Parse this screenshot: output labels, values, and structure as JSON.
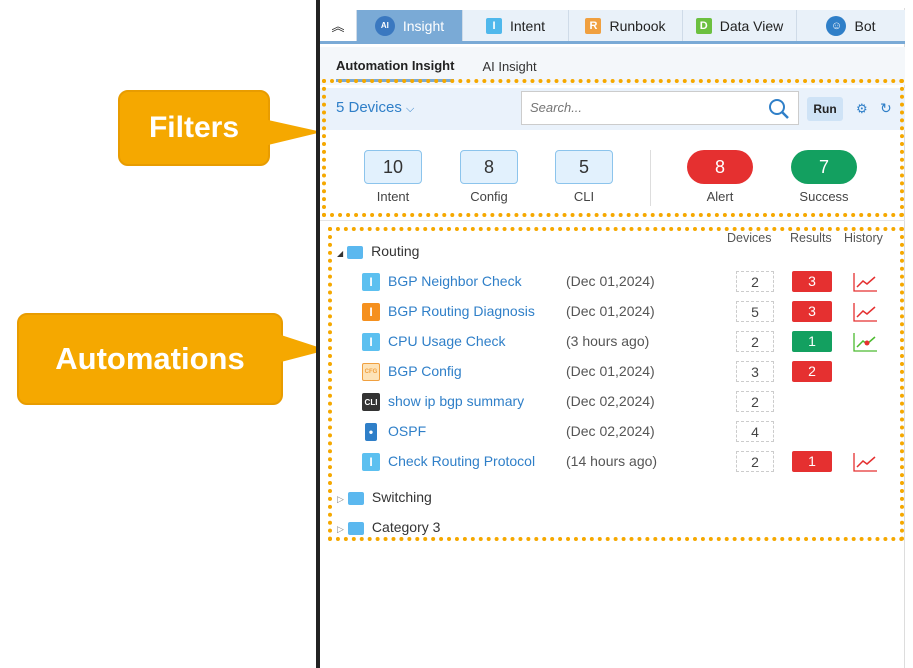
{
  "callouts": {
    "filters": "Filters",
    "automations": "Automations"
  },
  "tabs": [
    {
      "label": "Insight",
      "icon": "ai-insight-icon",
      "active": true
    },
    {
      "label": "Intent",
      "icon": "intent-icon",
      "letter": "I"
    },
    {
      "label": "Runbook",
      "icon": "runbook-icon",
      "letter": "R"
    },
    {
      "label": "Data View",
      "icon": "data-view-icon",
      "letter": "D"
    },
    {
      "label": "Bot",
      "icon": "bot-icon"
    }
  ],
  "subtabs": [
    {
      "label": "Automation Insight",
      "active": true
    },
    {
      "label": "AI Insight"
    }
  ],
  "filters": {
    "devices": "5 Devices",
    "search_placeholder": "Search...",
    "run": "Run"
  },
  "counts": [
    {
      "value": "10",
      "label": "Intent"
    },
    {
      "value": "8",
      "label": "Config"
    },
    {
      "value": "5",
      "label": "CLI"
    }
  ],
  "statuses": [
    {
      "value": "8",
      "label": "Alert",
      "color": "#e53030"
    },
    {
      "value": "7",
      "label": "Success",
      "color": "#13a060"
    }
  ],
  "columns": {
    "devices": "Devices",
    "results": "Results",
    "history": "History"
  },
  "folders": [
    {
      "name": "Routing",
      "expanded": true
    },
    {
      "name": "Switching"
    },
    {
      "name": "Category 3"
    }
  ],
  "automations": [
    {
      "name": "BGP Neighbor Check",
      "date": "(Dec 01,2024)",
      "devices": "2",
      "result": "3",
      "status": "alert",
      "type": "intent-blue",
      "history": "red"
    },
    {
      "name": "BGP Routing Diagnosis",
      "date": "(Dec 01,2024)",
      "devices": "5",
      "result": "3",
      "status": "alert",
      "type": "intent-orange",
      "history": "red"
    },
    {
      "name": "CPU Usage Check",
      "date": "(3 hours ago)",
      "devices": "2",
      "result": "1",
      "status": "success",
      "type": "intent-blue",
      "history": "green"
    },
    {
      "name": "BGP Config",
      "date": "(Dec 01,2024)",
      "devices": "3",
      "result": "2",
      "status": "alert",
      "type": "config"
    },
    {
      "name": "show ip bgp summary",
      "date": "(Dec 02,2024)",
      "devices": "2",
      "type": "cli",
      "icon_text": "CLI"
    },
    {
      "name": "OSPF",
      "date": "(Dec 02,2024)",
      "devices": "4",
      "type": "ospf"
    },
    {
      "name": "Check Routing Protocol",
      "date": "(14 hours ago)",
      "devices": "2",
      "result": "1",
      "status": "alert",
      "type": "intent-blue",
      "history": "red"
    }
  ],
  "colors": {
    "accent": "#7aaad6",
    "alert": "#e53030",
    "success": "#13a060",
    "callout": "#f5a800",
    "link": "#2f7fc8"
  }
}
